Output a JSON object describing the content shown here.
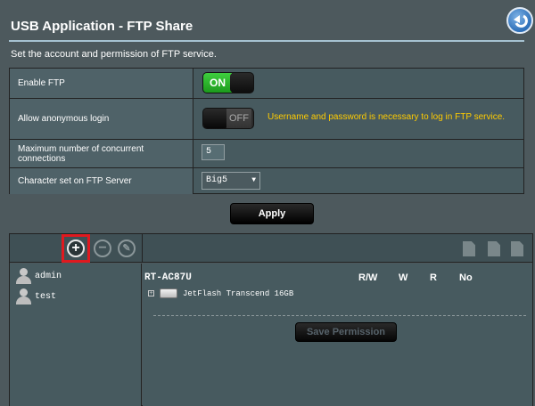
{
  "header": {
    "title": "USB Application - FTP Share",
    "subtitle": "Set the account and permission of FTP service."
  },
  "settings": {
    "enable_ftp": {
      "label": "Enable FTP",
      "state": "ON"
    },
    "anonymous": {
      "label": "Allow anonymous login",
      "state": "OFF",
      "note": "Username and password is necessary to log in FTP service."
    },
    "max_conn": {
      "label": "Maximum number of concurrent connections",
      "value": "5"
    },
    "charset": {
      "label": "Character set on FTP Server",
      "selected": "Big5"
    }
  },
  "apply_label": "Apply",
  "users": [
    {
      "name": "admin"
    },
    {
      "name": "test"
    }
  ],
  "permissions": {
    "router": "RT-AC87U",
    "columns": [
      "R/W",
      "W",
      "R",
      "No"
    ],
    "device": "JetFlash Transcend 16GB",
    "save_label": "Save Permission"
  },
  "icons": {
    "back": "back-arrow-icon",
    "add": "add-icon",
    "remove": "remove-icon",
    "edit": "edit-icon"
  },
  "colors": {
    "background": "#4d595d",
    "toggle_on": "#2bb52b",
    "warning": "#ffcc00",
    "highlight": "#e0191f"
  }
}
